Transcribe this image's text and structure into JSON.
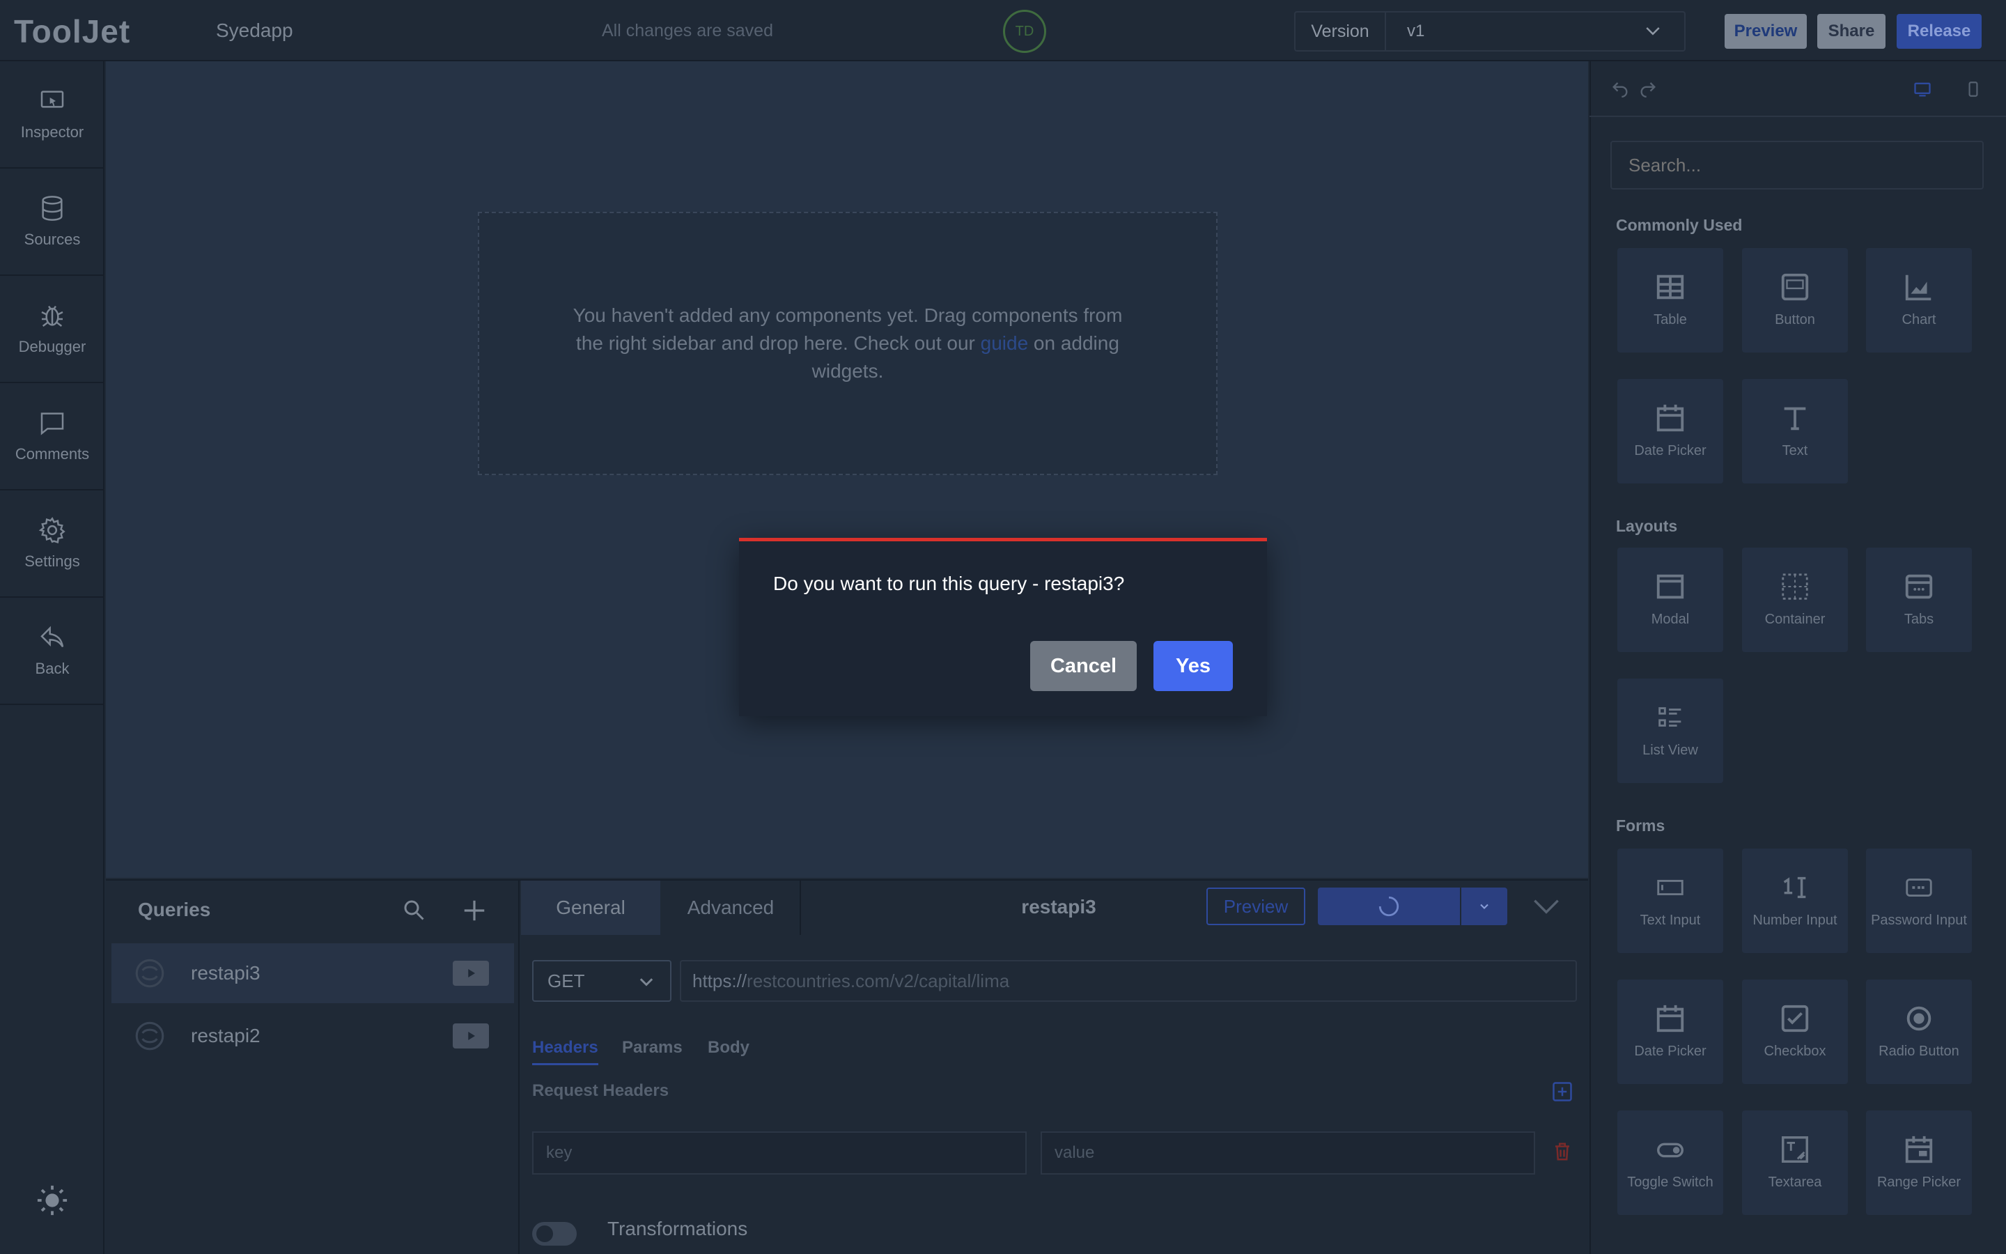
{
  "header": {
    "logo": "ToolJet",
    "app_name": "Syedapp",
    "save_status": "All changes are saved",
    "avatar_initials": "TD",
    "version_label": "Version",
    "version_value": "v1",
    "preview_label": "Preview",
    "share_label": "Share",
    "release_label": "Release"
  },
  "sidebar": {
    "items": [
      {
        "label": "Inspector",
        "icon": "inspector-icon"
      },
      {
        "label": "Sources",
        "icon": "database-icon"
      },
      {
        "label": "Debugger",
        "icon": "bug-icon"
      },
      {
        "label": "Comments",
        "icon": "comment-icon"
      },
      {
        "label": "Settings",
        "icon": "gear-icon"
      },
      {
        "label": "Back",
        "icon": "back-arrow-icon"
      }
    ]
  },
  "canvas": {
    "empty_text_before": "You haven't added any components yet. Drag components from the right sidebar and drop here. Check out our ",
    "empty_link": "guide",
    "empty_text_after": " on adding widgets."
  },
  "widgets": {
    "search_placeholder": "Search...",
    "sections": [
      {
        "title": "Commonly Used",
        "items": [
          "Table",
          "Button",
          "Chart",
          "Date Picker",
          "Text"
        ]
      },
      {
        "title": "Layouts",
        "items": [
          "Modal",
          "Container",
          "Tabs",
          "List View"
        ]
      },
      {
        "title": "Forms",
        "items": [
          "Text Input",
          "Number Input",
          "Password Input",
          "Date Picker",
          "Checkbox",
          "Radio Button",
          "Toggle Switch",
          "Textarea",
          "Range Picker"
        ]
      }
    ]
  },
  "queries": {
    "title": "Queries",
    "items": [
      {
        "name": "restapi3",
        "active": true
      },
      {
        "name": "restapi2",
        "active": false
      }
    ]
  },
  "editor": {
    "tabs": [
      "General",
      "Advanced"
    ],
    "query_name": "restapi3",
    "preview_label": "Preview",
    "method": "GET",
    "url_protocol": "https://",
    "url_rest": "restcountries.com/v2/capital/lima",
    "subtabs": [
      "Headers",
      "Params",
      "Body"
    ],
    "request_headers_label": "Request Headers",
    "key_placeholder": "key",
    "value_placeholder": "value",
    "transformations_label": "Transformations"
  },
  "modal": {
    "message": "Do you want to run this query - restapi3?",
    "cancel_label": "Cancel",
    "yes_label": "Yes"
  },
  "colors": {
    "accent": "#4369ee",
    "danger": "#d9312b",
    "background": "#1f2936",
    "canvas": "#263345"
  }
}
